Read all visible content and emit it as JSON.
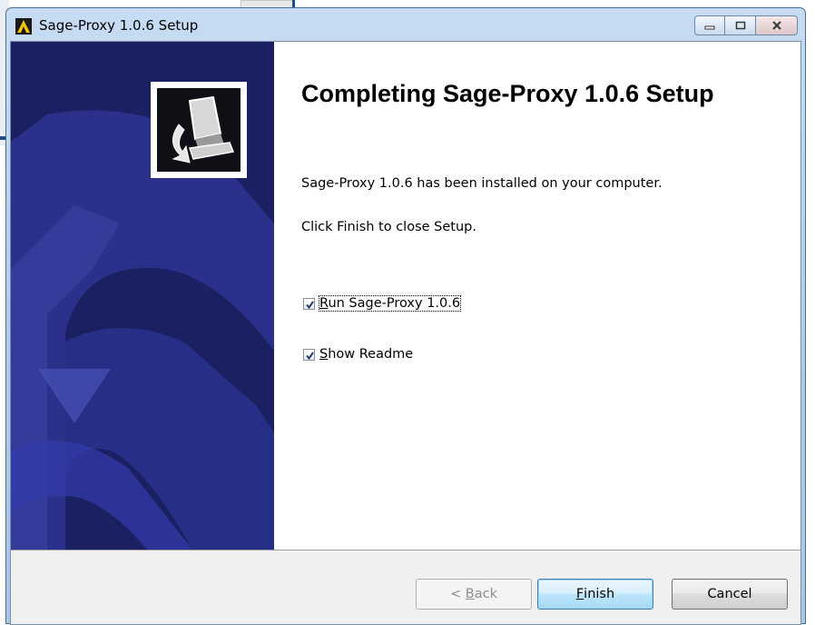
{
  "window": {
    "title": "Sage-Proxy 1.0.6 Setup",
    "controls": {
      "minimize": "–",
      "maximize": "□",
      "close": "✕"
    }
  },
  "content": {
    "heading": "Completing Sage-Proxy 1.0.6 Setup",
    "installed_text": "Sage-Proxy 1.0.6 has been installed on your computer.",
    "finish_hint": "Click Finish to close Setup."
  },
  "options": [
    {
      "label_accel": "R",
      "label_rest": "un Sage-Proxy 1.0.6",
      "checked": true
    },
    {
      "label_accel": "S",
      "label_rest": "how Readme",
      "checked": true
    }
  ],
  "buttons": {
    "back": {
      "prefix": "< ",
      "accel": "B",
      "rest": "ack",
      "enabled": false
    },
    "finish": {
      "accel": "F",
      "rest": "inish",
      "default": true
    },
    "cancel": {
      "label": "Cancel"
    }
  },
  "colors": {
    "banner": "#1b2063",
    "accent": "#3c7fb1"
  }
}
